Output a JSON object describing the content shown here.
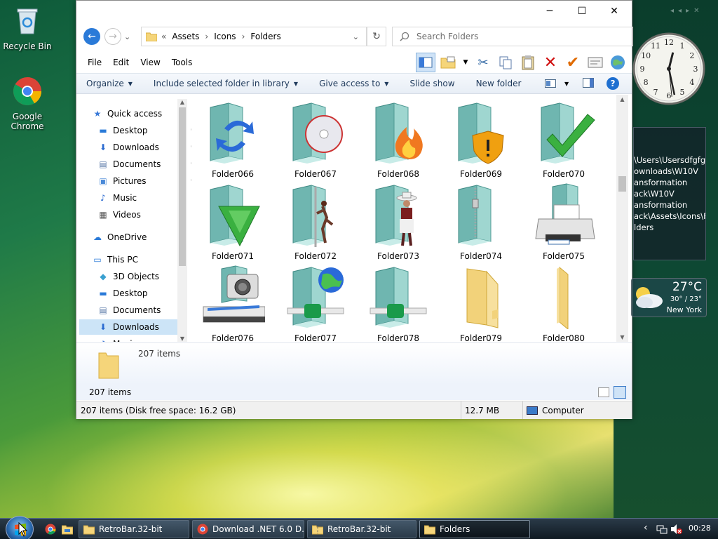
{
  "desktop": {
    "icons": [
      {
        "label": "Recycle Bin",
        "icon": "recycle-bin-icon"
      },
      {
        "label": "Google Chrome",
        "icon": "chrome-icon"
      }
    ]
  },
  "window": {
    "controls": {
      "minimize": "─",
      "maximize": "☐",
      "close": "✕"
    },
    "nav": {
      "back": "←",
      "forward": "→",
      "recent": "⌄",
      "up_dropdown": "⌄",
      "refresh": "↻"
    },
    "address": {
      "prefix": "«",
      "crumbs": [
        "Assets",
        "Icons",
        "Folders"
      ],
      "sep": "›"
    },
    "search": {
      "placeholder": "Search Folders"
    },
    "menu": [
      "File",
      "Edit",
      "View",
      "Tools"
    ],
    "commands": [
      "Organize",
      "Include selected folder in library",
      "Give access to",
      "Slide show",
      "New folder"
    ],
    "help": "?",
    "nav_pane": [
      {
        "label": "Quick access",
        "icon": "star-icon",
        "indent": 0
      },
      {
        "label": "Desktop",
        "icon": "desktop-icon",
        "indent": 1,
        "pinned": true
      },
      {
        "label": "Downloads",
        "icon": "download-icon",
        "indent": 1,
        "pinned": true
      },
      {
        "label": "Documents",
        "icon": "documents-icon",
        "indent": 1,
        "pinned": true
      },
      {
        "label": "Pictures",
        "icon": "pictures-icon",
        "indent": 1,
        "pinned": true
      },
      {
        "label": "Music",
        "icon": "music-icon",
        "indent": 1
      },
      {
        "label": "Videos",
        "icon": "videos-icon",
        "indent": 1
      },
      {
        "label": "OneDrive",
        "icon": "cloud-icon",
        "indent": 0
      },
      {
        "label": "This PC",
        "icon": "computer-icon",
        "indent": 0
      },
      {
        "label": "3D Objects",
        "icon": "cube-icon",
        "indent": 1
      },
      {
        "label": "Desktop",
        "icon": "desktop-icon",
        "indent": 1
      },
      {
        "label": "Documents",
        "icon": "documents-icon",
        "indent": 1
      },
      {
        "label": "Downloads",
        "icon": "download-icon",
        "indent": 1,
        "selected": true
      },
      {
        "label": "Music",
        "icon": "music-icon",
        "indent": 1
      }
    ],
    "pin_glyph": "📌",
    "files": [
      {
        "name": "Folder066",
        "overlay": "refresh-arrows-icon"
      },
      {
        "name": "Folder067",
        "overlay": "disc-icon"
      },
      {
        "name": "Folder068",
        "overlay": "flame-icon"
      },
      {
        "name": "Folder069",
        "overlay": "warning-shield-icon"
      },
      {
        "name": "Folder070",
        "overlay": "checkmark-icon"
      },
      {
        "name": "Folder071",
        "overlay": "green-triangle-icon"
      },
      {
        "name": "Folder072",
        "overlay": "dancer-icon"
      },
      {
        "name": "Folder073",
        "overlay": "cowboy-icon"
      },
      {
        "name": "Folder074",
        "overlay": "zipper-icon"
      },
      {
        "name": "Folder075",
        "overlay": "printer-icon"
      },
      {
        "name": "Folder076",
        "overlay": "scanner-camera-icon"
      },
      {
        "name": "Folder077",
        "overlay": "globe-network-icon"
      },
      {
        "name": "Folder078",
        "overlay": "network-cable-icon"
      },
      {
        "name": "Folder079",
        "overlay": "yellow-folder-icon"
      },
      {
        "name": "Folder080",
        "overlay": "yellow-folder-icon"
      }
    ],
    "details": {
      "count": "207 items"
    },
    "status_line": "207 items",
    "statusbar": {
      "left": "207 items (Disk free space: 16.2 GB)",
      "size": "12.7 MB",
      "location": "Computer"
    }
  },
  "gadgets": {
    "clock": {
      "numbers": [
        "12",
        "1",
        "2",
        "3",
        "4",
        "5",
        "6",
        "7",
        "8",
        "9",
        "10",
        "11"
      ]
    },
    "path_lines": [
      "\\Users\\Usersdfgfg\\",
      "ownloads\\W10V",
      "ansformation",
      "ack\\W10V",
      "ansformation",
      "ack\\Assets\\Icons\\F",
      "lders"
    ],
    "weather": {
      "temp": "27°C",
      "range": "30° / 23°",
      "city": "New York"
    },
    "nav_arrows": [
      "◂",
      "◂",
      "▸",
      "✕"
    ]
  },
  "taskbar": {
    "buttons": [
      {
        "label": "RetroBar.32-bit",
        "icon": "folder-icon",
        "active": false
      },
      {
        "label": "Download .NET 6.0 D...",
        "icon": "chrome-icon",
        "active": false
      },
      {
        "label": "RetroBar.32-bit",
        "icon": "zip-folder-icon",
        "active": false
      },
      {
        "label": "Folders",
        "icon": "folder-icon",
        "active": true
      }
    ],
    "tray": {
      "chevron": "‹",
      "time": "00:28"
    }
  },
  "colors": {
    "accent": "#0078d7",
    "command_text": "#1e395b",
    "folder_yellow": "#f5d57a",
    "folder_teal": "#7fc8c0"
  }
}
